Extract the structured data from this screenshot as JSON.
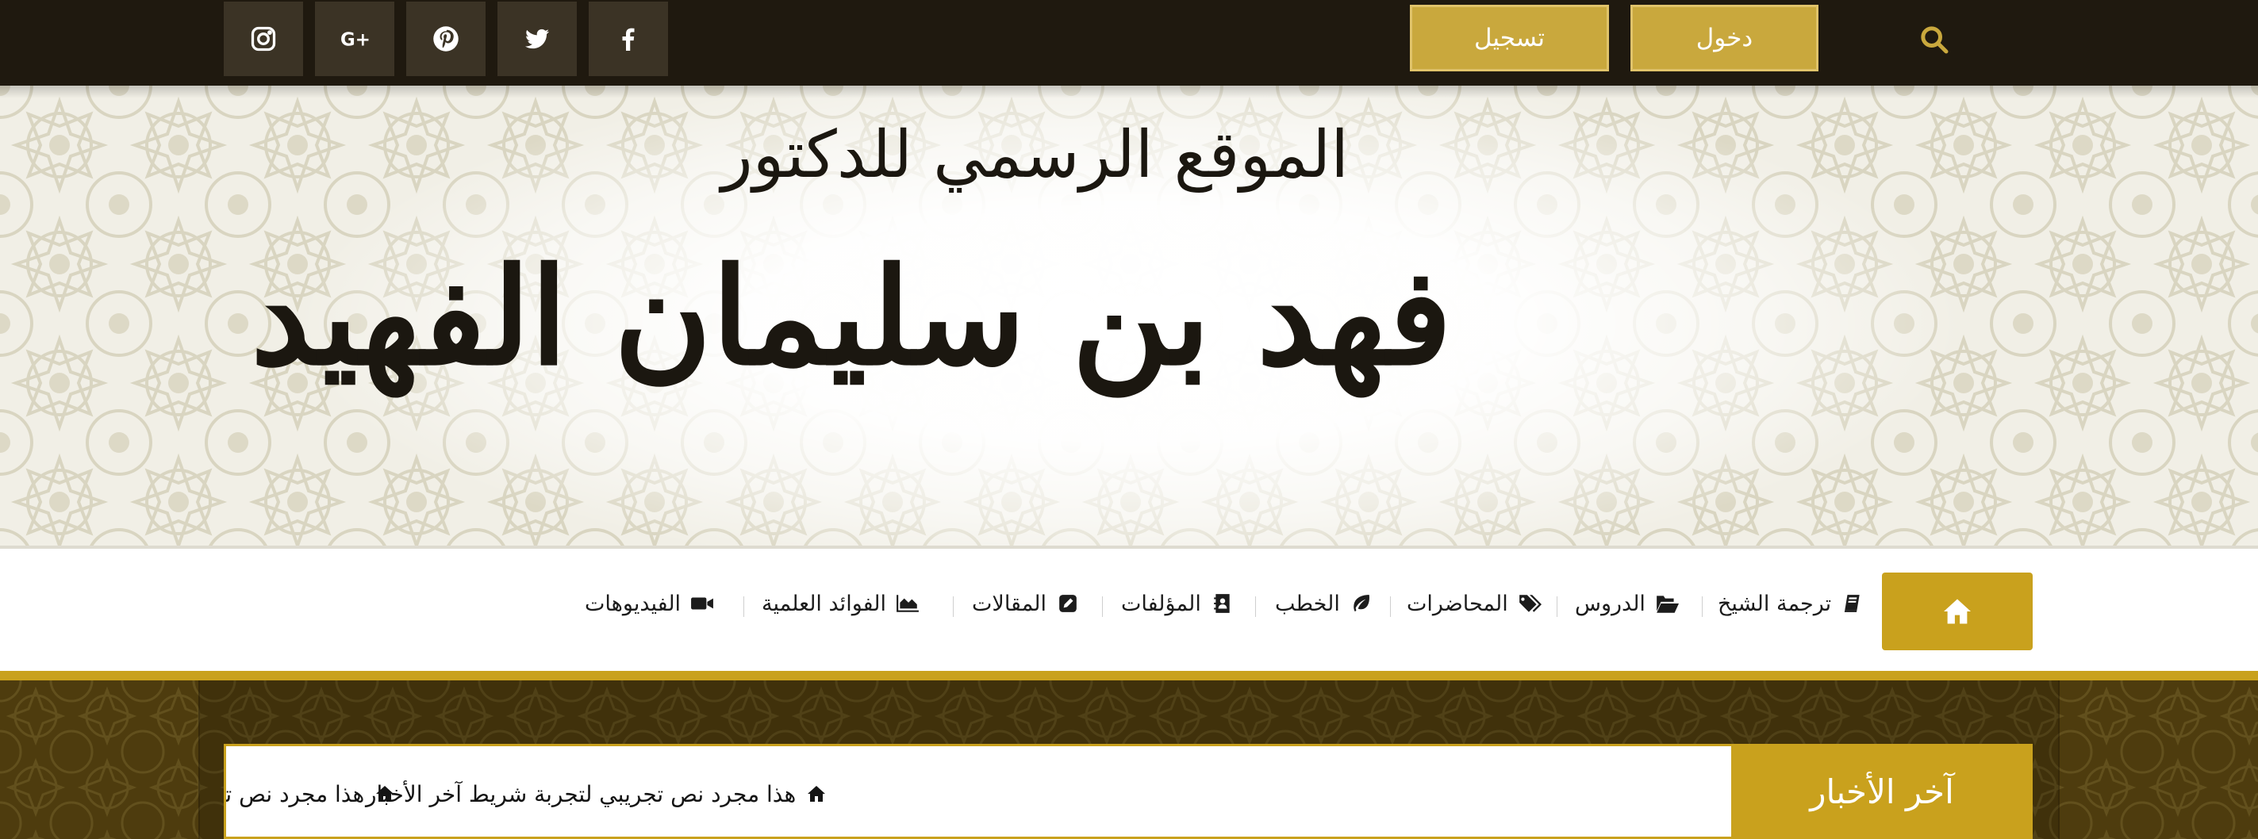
{
  "topbar": {
    "social": [
      {
        "name": "instagram-icon"
      },
      {
        "name": "google-plus-icon"
      },
      {
        "name": "pinterest-icon"
      },
      {
        "name": "twitter-icon"
      },
      {
        "name": "facebook-icon"
      }
    ],
    "register_label": "تسجيل",
    "login_label": "دخول",
    "search_icon": "search-icon"
  },
  "banner": {
    "logo_line1": "الموقع الرسمي للدكتور",
    "logo_line2": "فهد بن سليمان الفهيد"
  },
  "nav": {
    "home_icon": "home-icon",
    "items": [
      {
        "label": "ترجمة الشيخ",
        "icon": "book-icon"
      },
      {
        "label": "الدروس",
        "icon": "folder-open-icon"
      },
      {
        "label": "المحاضرات",
        "icon": "tags-icon"
      },
      {
        "label": "الخطب",
        "icon": "leaf-icon"
      },
      {
        "label": "المؤلفات",
        "icon": "address-book-icon"
      },
      {
        "label": "المقالات",
        "icon": "edit-icon"
      },
      {
        "label": "الفوائد العلمية",
        "icon": "area-chart-icon"
      },
      {
        "label": "الفيديوهات",
        "icon": "video-camera-icon"
      }
    ]
  },
  "ticker": {
    "label": "آخر الأخبار",
    "items": [
      "هذا مجرد نص تجريبي لتجربة شريط آخر الأخبار",
      "هذا مجرد نص تجريبي لتجربة شريط آخر الأخبار"
    ]
  },
  "colors": {
    "topbar": "#1f190f",
    "social_tile": "#3b3325",
    "auth_button": "#c9a83d",
    "accent_gold": "#c9a11d",
    "pattern_dark": "#4e3c0e"
  }
}
